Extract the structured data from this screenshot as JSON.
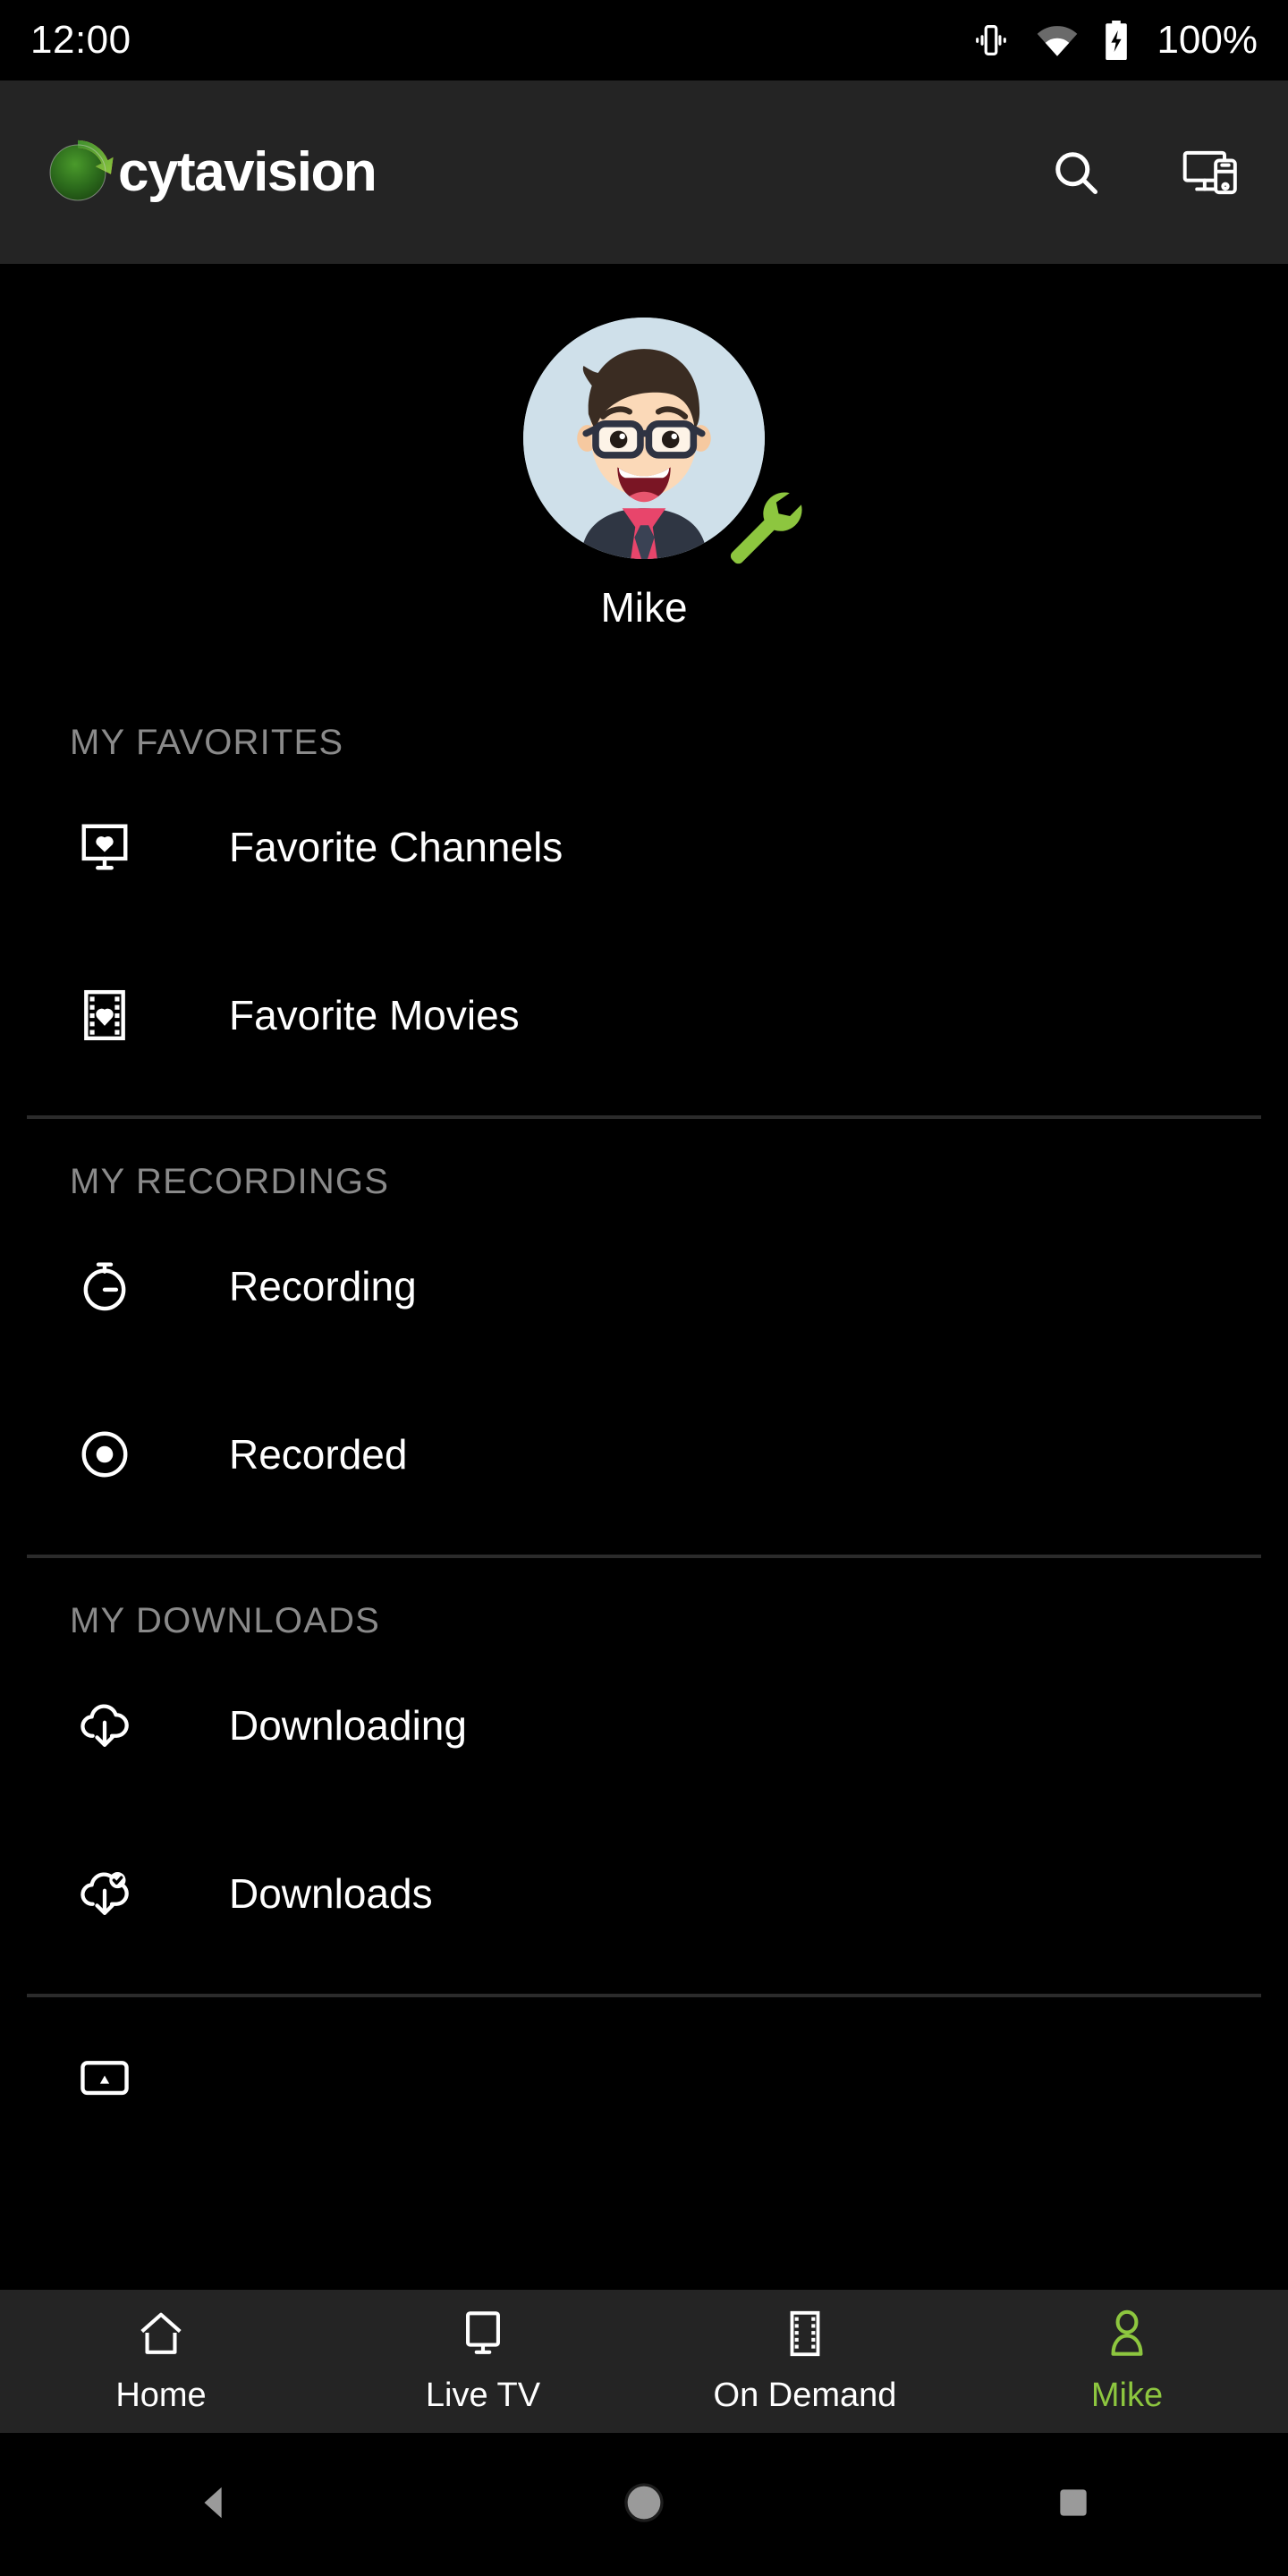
{
  "status_bar": {
    "time": "12:00",
    "battery_percent": "100%",
    "icons": [
      "vibrate-icon",
      "wifi-icon",
      "battery-charging-icon"
    ]
  },
  "app_bar": {
    "brand_name": "cytavision",
    "logo_name": "cytavision-logo",
    "actions": [
      {
        "name": "search-icon",
        "label": "Search"
      },
      {
        "name": "cast-devices-icon",
        "label": "Cast"
      }
    ]
  },
  "profile": {
    "name": "Mike",
    "avatar_name": "user-avatar",
    "settings_name": "wrench-settings-icon",
    "accent_color": "#8dc63f",
    "avatar_bg": "#cfe0ea"
  },
  "menu": {
    "sections": [
      {
        "title": "MY FAVORITES",
        "items": [
          {
            "label": "Favorite Channels",
            "icon": "tv-heart-icon"
          },
          {
            "label": "Favorite Movies",
            "icon": "film-heart-icon"
          }
        ]
      },
      {
        "title": "MY RECORDINGS",
        "items": [
          {
            "label": "Recording",
            "icon": "timer-icon"
          },
          {
            "label": "Recorded",
            "icon": "record-dot-icon"
          }
        ]
      },
      {
        "title": "MY DOWNLOADS",
        "items": [
          {
            "label": "Downloading",
            "icon": "cloud-download-icon"
          },
          {
            "label": "Downloads",
            "icon": "cloud-download-check-icon"
          }
        ]
      }
    ]
  },
  "bottom_nav": {
    "items": [
      {
        "label": "Home",
        "icon": "home-icon",
        "active": false
      },
      {
        "label": "Live TV",
        "icon": "monitor-icon",
        "active": false
      },
      {
        "label": "On Demand",
        "icon": "film-strip-icon",
        "active": false
      },
      {
        "label": "Mike",
        "icon": "person-icon",
        "active": true
      }
    ]
  },
  "android_nav": {
    "buttons": [
      {
        "name": "back-button",
        "icon": "triangle-back-icon"
      },
      {
        "name": "home-button",
        "icon": "circle-home-icon"
      },
      {
        "name": "recents-button",
        "icon": "square-recents-icon"
      }
    ]
  }
}
